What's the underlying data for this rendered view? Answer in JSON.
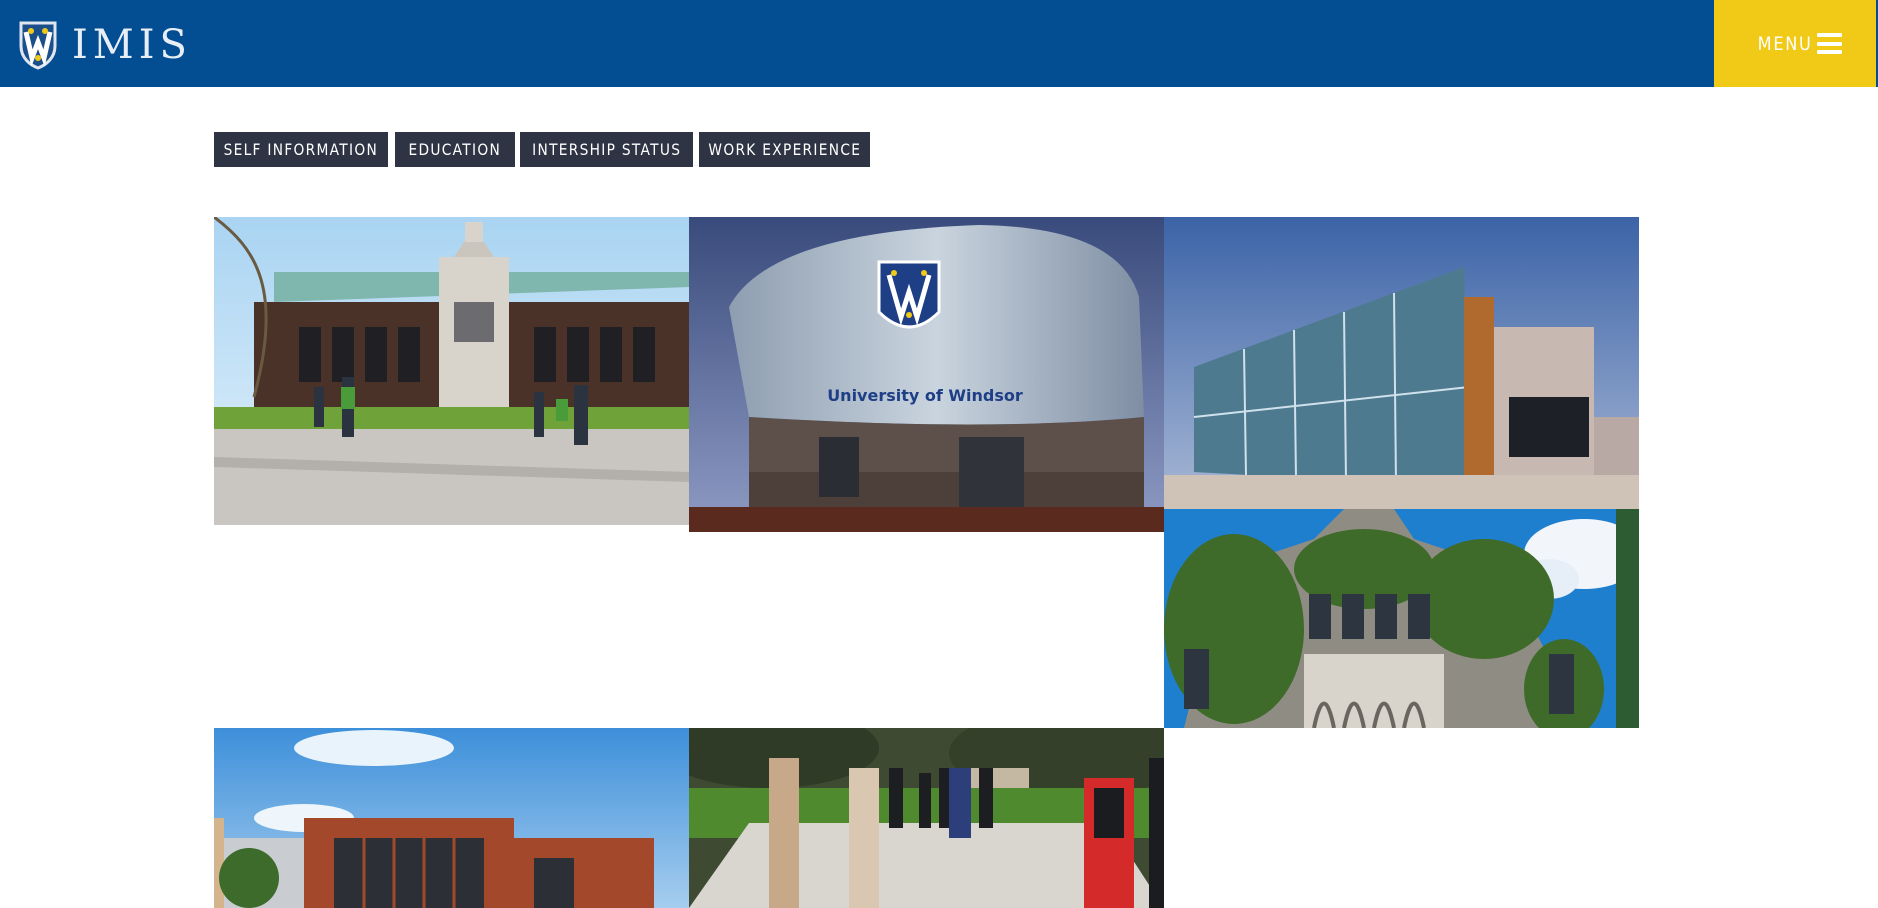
{
  "header": {
    "logo_icon": "university-shield-icon",
    "title": "IMIS",
    "menu_label": "MENU",
    "menu_icon": "hamburger-icon",
    "colors": {
      "bar": "#034d93",
      "menu": "#f1ca18",
      "tab": "#2e3444"
    }
  },
  "tabs": [
    {
      "label": "SELF INFORMATION"
    },
    {
      "label": "EDUCATION"
    },
    {
      "label": "INTERSHIP STATUS"
    },
    {
      "label": "WORK EXPERIENCE"
    }
  ],
  "gallery": {
    "photo2_sign": "University of Windsor"
  }
}
